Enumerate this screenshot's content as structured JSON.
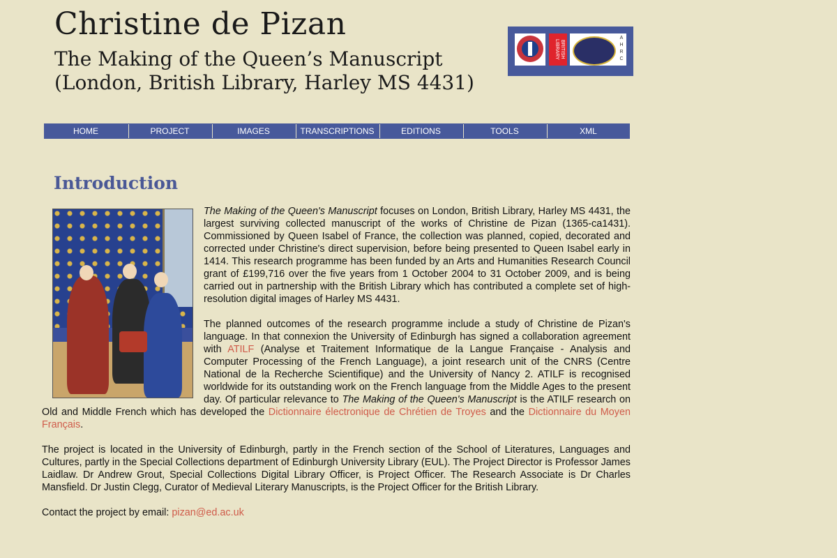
{
  "header": {
    "title": "Christine de Pizan",
    "subtitle": "The Making of the Queen’s Manuscript",
    "subtitle2": "(London, British Library, Harley MS 4431)"
  },
  "logos": {
    "edinburgh": "The University of Edinburgh",
    "british_library": "BRITISH LIBRARY",
    "ahrc_letters": [
      "A",
      "H",
      "R",
      "C"
    ]
  },
  "nav": {
    "items": [
      "HOME",
      "PROJECT",
      "IMAGES",
      "TRANSCRIPTIONS",
      "EDITIONS",
      "TOOLS",
      "XML"
    ]
  },
  "page_title": "Introduction",
  "content": {
    "p1": {
      "italic_title": "The Making of the Queen's Manuscript",
      "text": " focuses on London, British Library, Harley MS 4431, the largest surviving collected manuscript of the works of Christine de Pizan (1365-ca1431). Commissioned by Queen Isabel of France, the collection was planned, copied, decorated and corrected under Christine's direct supervision, before being presented to Queen Isabel early in 1414. This research programme has been funded by an Arts and Humanities Research Council grant of £199,716 over the five years from 1 October 2004 to 31 October 2009, and is being carried out in partnership with the British Library which has contributed a complete set of high-resolution digital images of Harley MS 4431."
    },
    "p2": {
      "a": "The planned outcomes of the research programme include a study of Christine de Pizan's language. In that connexion the University of Edinburgh has signed a collaboration agreement with ",
      "link_atilf": "ATILF",
      "b": " (Analyse et Traitement Informatique de la Langue Française - Analysis and Computer Processing of the French Language), a joint research unit of the CNRS (Centre National de la Recherche Scientifique) and the University of Nancy 2. ATILF is recognised worldwide for its outstanding work on the French language from the Middle Ages to the present day. Of particular relevance to ",
      "italic_title": "The Making of the Queen's Manuscript",
      "c": " is the ATILF research on Old and Middle French which has developed the ",
      "link_dect": "Dictionnaire électronique de Chrétien de Troyes",
      "d": " and the ",
      "link_dmf": "Dictionnaire du Moyen Français",
      "e": "."
    },
    "p3": "The project is located in the University of Edinburgh, partly in the French section of the School of Literatures, Languages and Cultures, partly in the Special Collections department of Edinburgh University Library (EUL). The Project Director is Professor James Laidlaw. Dr Andrew Grout, Special Collections Digital Library Officer, is Project Officer. The Research Associate is Dr Charles Mansfield. Dr Justin Clegg, Curator of Medieval Literary Manuscripts, is the Project Officer for the British Library.",
    "contact_label": "Contact the project by email: ",
    "contact_email": "pizan@ed.ac.uk"
  },
  "colors": {
    "background": "#e9e4c8",
    "nav": "#47599b",
    "heading": "#4a5896",
    "link": "#cf5b4a"
  }
}
